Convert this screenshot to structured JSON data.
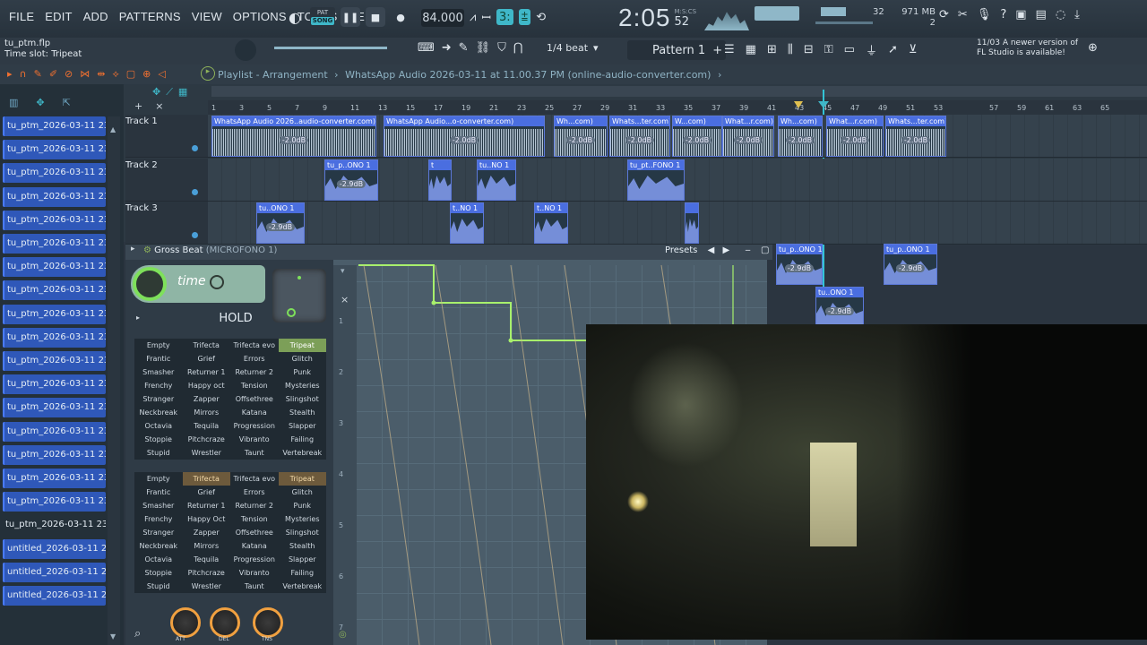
{
  "menu": [
    "FILE",
    "EDIT",
    "ADD",
    "PATTERNS",
    "VIEW",
    "OPTIONS",
    "TOOLS",
    "HELP"
  ],
  "transport": {
    "mode_pat": "PAT",
    "mode_song": "SONG",
    "tempo": "84.000"
  },
  "clock": {
    "time": "2:05",
    "sub": "52",
    "unit": "M:S:CS"
  },
  "cpu": {
    "value": "32",
    "mem": "971 MB",
    "poly": "2"
  },
  "project": {
    "file": "tu_ptm.flp",
    "hint": "Time slot: Tripeat"
  },
  "snap": "1/4 beat",
  "pattern": "Pattern 1",
  "update": {
    "date": "11/03",
    "text": "A newer version of FL Studio is available!"
  },
  "playlist": {
    "title": "Playlist - Arrangement",
    "breadcrumb": "WhatsApp Audio 2026-03-11 at 11.00.37 PM (online-audio-converter.com)"
  },
  "sidebar": [
    "tu_ptm_2026-03-11 23-2...",
    "tu_ptm_2026-03-11 23-2...",
    "tu_ptm_2026-03-11 23-2...",
    "tu_ptm_2026-03-11 23-2...",
    "tu_ptm_2026-03-11 23-2...",
    "tu_ptm_2026-03-11 23-2...",
    "tu_ptm_2026-03-11 23-2...",
    "tu_ptm_2026-03-11 23-2...",
    "tu_ptm_2026-03-11 23-2...",
    "tu_ptm_2026-03-11 23-2...",
    "tu_ptm_2026-03-11 23-2...",
    "tu_ptm_2026-03-11 23-2...",
    "tu_ptm_2026-03-11 23-2...",
    "tu_ptm_2026-03-11 23-2...",
    "tu_ptm_2026-03-11 23-2...",
    "tu_ptm_2026-03-11 23-3...",
    "tu_ptm_2026-03-11 23-3...",
    "tu_ptm_2026-03-11 23-3...",
    "untitled_2026-03-11 23-...",
    "untitled_2026-03-11 23-...",
    "untitled_2026-03-11 23-..."
  ],
  "ruler": [
    "1",
    "3",
    "5",
    "7",
    "9",
    "11",
    "13",
    "15",
    "17",
    "19",
    "21",
    "23",
    "25",
    "27",
    "29",
    "31",
    "33",
    "35",
    "37",
    "39",
    "41",
    "43",
    "45",
    "47",
    "49",
    "51",
    "53",
    "57",
    "59",
    "61",
    "63",
    "65"
  ],
  "tracks": [
    {
      "name": "Track 1",
      "clips": [
        {
          "label": "WhatsApp Audio 2026..audio-converter.com)",
          "db": "-2.0dB"
        },
        {
          "label": "WhatsApp Audio...o-converter.com)",
          "db": "-2.0dB"
        },
        {
          "label": "Wh...com)",
          "db": "-2.0dB"
        },
        {
          "label": "Whats...ter.com)",
          "db": "-2.0dB"
        },
        {
          "label": "W...com)",
          "db": "-2.0dB"
        },
        {
          "label": "What...r.com)",
          "db": "-2.0dB"
        },
        {
          "label": "Wh...com)",
          "db": "-2.0dB"
        },
        {
          "label": "What...r.com)",
          "db": "-2.0dB"
        },
        {
          "label": "Whats...ter.com)",
          "db": "-2.0dB"
        }
      ]
    },
    {
      "name": "Track 2",
      "clips": [
        {
          "label": "tu_p..ONO 1",
          "db": "-2.9dB"
        },
        {
          "label": "t",
          "db": ""
        },
        {
          "label": "tu..NO 1",
          "db": ""
        },
        {
          "label": "tu_pt..FONO 1",
          "db": ""
        }
      ]
    },
    {
      "name": "Track 3",
      "clips": [
        {
          "label": "tu..ONO 1",
          "db": "-2.9dB"
        },
        {
          "label": "t..NO 1",
          "db": ""
        },
        {
          "label": "t..NO 1",
          "db": ""
        },
        {
          "label": "",
          "db": ""
        }
      ]
    }
  ],
  "overflow_clips": [
    {
      "label": "tu_p..ONO 1",
      "db": "-2.9dB"
    },
    {
      "label": "tu_p..ONO 1",
      "db": "-2.9dB"
    },
    {
      "label": "tu..ONO 1",
      "db": "-2.9dB"
    }
  ],
  "grossbeat": {
    "title": "Gross Beat",
    "instance": "(MICROFONO 1)",
    "presets": "Presets",
    "time_label": "time",
    "hold": "HOLD",
    "time_presets": [
      [
        "Empty",
        "Trifecta",
        "Trifecta evo",
        "Tripeat"
      ],
      [
        "Frantic",
        "Grief",
        "Errors",
        "Glitch"
      ],
      [
        "Smasher",
        "Returner 1",
        "Returner 2",
        "Punk"
      ],
      [
        "Frenchy",
        "Happy oct",
        "Tension",
        "Mysteries"
      ],
      [
        "Stranger",
        "Zapper",
        "Offsethree",
        "Slingshot"
      ],
      [
        "Neckbreak",
        "Mirrors",
        "Katana",
        "Stealth"
      ],
      [
        "Octavia",
        "Tequila",
        "Progression",
        "Slapper"
      ],
      [
        "Stoppie",
        "Pitchcraze",
        "Vibranto",
        "Failing"
      ],
      [
        "Stupid",
        "Wrestler",
        "Taunt",
        "Vertebreak"
      ]
    ],
    "vol_presets": [
      [
        "Empty",
        "Trifecta",
        "Trifecta evo",
        "Tripeat"
      ],
      [
        "Frantic",
        "Grief",
        "Errors",
        "Glitch"
      ],
      [
        "Smasher",
        "Returner 1",
        "Returner 2",
        "Punk"
      ],
      [
        "Frenchy",
        "Happy Oct",
        "Tension",
        "Mysteries"
      ],
      [
        "Stranger",
        "Zapper",
        "Offsethree",
        "Slingshot"
      ],
      [
        "Neckbreak",
        "Mirrors",
        "Katana",
        "Stealth"
      ],
      [
        "Octavia",
        "Tequila",
        "Progression",
        "Slapper"
      ],
      [
        "Stoppie",
        "Pitchcraze",
        "Vibranto",
        "Failing"
      ],
      [
        "Stupid",
        "Wrestler",
        "Taunt",
        "Vertebreak"
      ]
    ],
    "y_axis": [
      "1",
      "2",
      "3",
      "4",
      "5",
      "6",
      "7"
    ],
    "knobs": [
      "ATT",
      "DEL",
      "TNS"
    ]
  }
}
